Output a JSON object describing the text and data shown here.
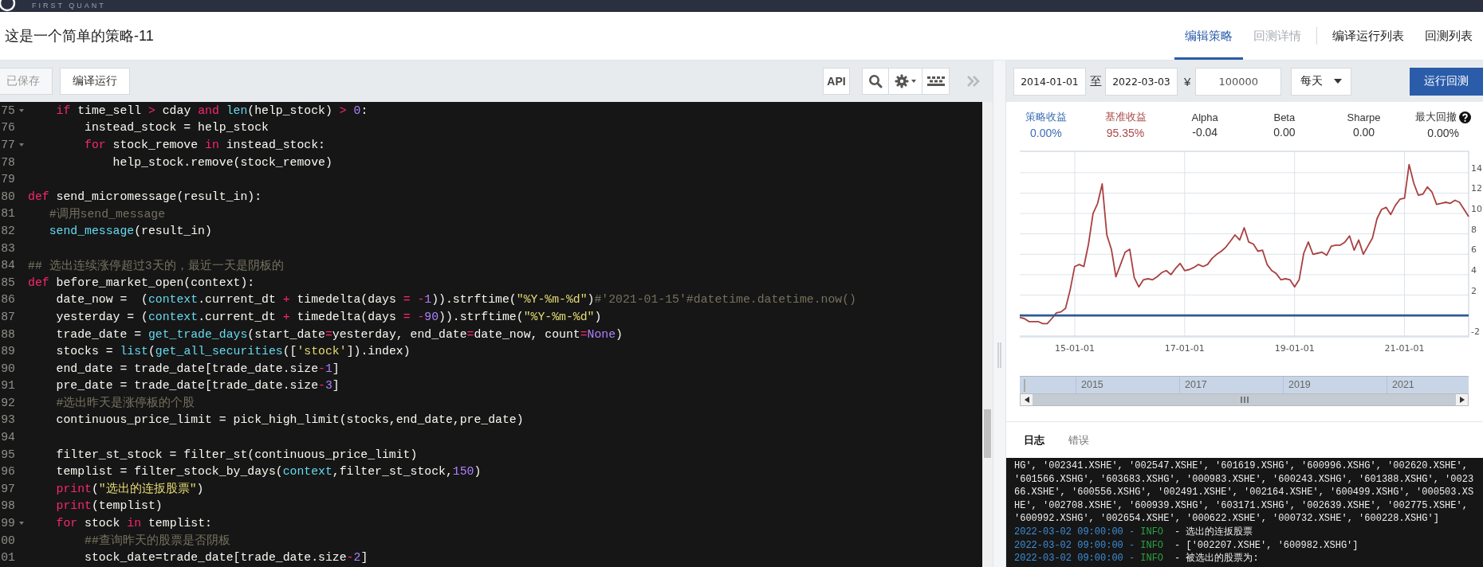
{
  "top_bar": {
    "brand": "FIRST QUANT"
  },
  "header": {
    "title": "这是一个简单的策略-11",
    "tabs": [
      {
        "label": "编辑策略",
        "selected": true,
        "disabled": false
      },
      {
        "label": "回测详情",
        "selected": false,
        "disabled": true
      },
      {
        "label": "编译运行列表",
        "selected": false,
        "disabled": false,
        "separator_before": true
      },
      {
        "label": "回测列表",
        "selected": false,
        "disabled": false
      }
    ]
  },
  "toolbar": {
    "buttons": [
      {
        "label": "已保存",
        "disabled": true
      },
      {
        "label": "编译运行",
        "disabled": false
      }
    ],
    "api_button": "API"
  },
  "editor": {
    "lines": [
      {
        "number": "75",
        "fold": true,
        "tokens": [
          {
            "kind": "kw",
            "text": "    if"
          },
          {
            "kind": "plain",
            "text": " time_sell "
          },
          {
            "kind": "op",
            "text": ">"
          },
          {
            "kind": "plain",
            "text": " cday "
          },
          {
            "kind": "kw",
            "text": "and "
          },
          {
            "kind": "builtin",
            "text": "len"
          },
          {
            "kind": "plain",
            "text": "(help_stock) "
          },
          {
            "kind": "op",
            "text": "> "
          },
          {
            "kind": "num",
            "text": "0"
          },
          {
            "kind": "plain",
            "text": ":"
          }
        ]
      },
      {
        "number": "76",
        "fold": false,
        "tokens": [
          {
            "kind": "plain",
            "text": "        instead_stock = help_stock"
          }
        ]
      },
      {
        "number": "77",
        "fold": true,
        "tokens": [
          {
            "kind": "kw",
            "text": "        for"
          },
          {
            "kind": "plain",
            "text": " stock_remove "
          },
          {
            "kind": "kw",
            "text": "in"
          },
          {
            "kind": "plain",
            "text": " instead_stock:"
          }
        ]
      },
      {
        "number": "78",
        "fold": false,
        "tokens": [
          {
            "kind": "plain",
            "text": "            help_stock.remove(stock_remove)"
          }
        ]
      },
      {
        "number": "79",
        "fold": false
      },
      {
        "number": "80",
        "fold": false,
        "tokens": [
          {
            "kind": "kw",
            "text": "def"
          },
          {
            "kind": "plain",
            "text": " send_micromessage(result_in):"
          }
        ]
      },
      {
        "number": "81",
        "fold": false,
        "tokens": [
          {
            "kind": "comment",
            "text": "   #调用send_message"
          }
        ]
      },
      {
        "number": "82",
        "fold": false,
        "tokens": [
          {
            "kind": "builtin",
            "text": "   send_message"
          },
          {
            "kind": "plain",
            "text": "(result_in)"
          }
        ]
      },
      {
        "number": "83",
        "fold": false
      },
      {
        "number": "84",
        "fold": false,
        "tokens": [
          {
            "kind": "comment",
            "text": "## 选出连续涨停超过3天的，最近一天是阴板的"
          }
        ]
      },
      {
        "number": "85",
        "fold": false,
        "tokens": [
          {
            "kind": "kw",
            "text": "def"
          },
          {
            "kind": "plain",
            "text": " before_market_open(context):"
          }
        ]
      },
      {
        "number": "86",
        "fold": false,
        "tokens": [
          {
            "kind": "plain",
            "text": "    date_now =  ("
          },
          {
            "kind": "param",
            "text": "context"
          },
          {
            "kind": "plain",
            "text": ".current_dt "
          },
          {
            "kind": "op",
            "text": "+"
          },
          {
            "kind": "plain",
            "text": " timedelta(days "
          },
          {
            "kind": "op",
            "text": "= -"
          },
          {
            "kind": "num",
            "text": "1"
          },
          {
            "kind": "plain",
            "text": ")).strftime("
          },
          {
            "kind": "str",
            "text": "\"%Y-%m-%d\""
          },
          {
            "kind": "plain",
            "text": ")"
          },
          {
            "kind": "comment",
            "text": "#'2021-01-15'#datetime.datetime.now()"
          }
        ]
      },
      {
        "number": "87",
        "fold": false,
        "tokens": [
          {
            "kind": "plain",
            "text": "    yesterday = ("
          },
          {
            "kind": "param",
            "text": "context"
          },
          {
            "kind": "plain",
            "text": ".current_dt "
          },
          {
            "kind": "op",
            "text": "+"
          },
          {
            "kind": "plain",
            "text": " timedelta(days "
          },
          {
            "kind": "op",
            "text": "= -"
          },
          {
            "kind": "num",
            "text": "90"
          },
          {
            "kind": "plain",
            "text": ")).strftime("
          },
          {
            "kind": "str",
            "text": "\"%Y-%m-%d\""
          },
          {
            "kind": "plain",
            "text": ")"
          }
        ]
      },
      {
        "number": "88",
        "fold": false,
        "tokens": [
          {
            "kind": "plain",
            "text": "    trade_date = "
          },
          {
            "kind": "builtin",
            "text": "get_trade_days"
          },
          {
            "kind": "plain",
            "text": "(start_date"
          },
          {
            "kind": "op",
            "text": "="
          },
          {
            "kind": "plain",
            "text": "yesterday, end_date"
          },
          {
            "kind": "op",
            "text": "="
          },
          {
            "kind": "plain",
            "text": "date_now, count"
          },
          {
            "kind": "op",
            "text": "="
          },
          {
            "kind": "num",
            "text": "None"
          },
          {
            "kind": "plain",
            "text": ")"
          }
        ]
      },
      {
        "number": "89",
        "fold": false,
        "tokens": [
          {
            "kind": "plain",
            "text": "    stocks = "
          },
          {
            "kind": "builtin",
            "text": "list"
          },
          {
            "kind": "plain",
            "text": "("
          },
          {
            "kind": "builtin",
            "text": "get_all_securities"
          },
          {
            "kind": "plain",
            "text": "(["
          },
          {
            "kind": "str",
            "text": "'stock'"
          },
          {
            "kind": "plain",
            "text": "]).index)"
          }
        ]
      },
      {
        "number": "90",
        "fold": false,
        "tokens": [
          {
            "kind": "plain",
            "text": "    end_date = trade_date[trade_date.size"
          },
          {
            "kind": "op",
            "text": "-"
          },
          {
            "kind": "num",
            "text": "1"
          },
          {
            "kind": "plain",
            "text": "]"
          }
        ]
      },
      {
        "number": "91",
        "fold": false,
        "tokens": [
          {
            "kind": "plain",
            "text": "    pre_date = trade_date[trade_date.size"
          },
          {
            "kind": "op",
            "text": "-"
          },
          {
            "kind": "num",
            "text": "3"
          },
          {
            "kind": "plain",
            "text": "]"
          }
        ]
      },
      {
        "number": "92",
        "fold": false,
        "tokens": [
          {
            "kind": "comment",
            "text": "    #选出昨天是涨停板的个股"
          }
        ]
      },
      {
        "number": "93",
        "fold": false,
        "tokens": [
          {
            "kind": "plain",
            "text": "    continuous_price_limit = pick_high_limit(stocks,end_date,pre_date)"
          }
        ]
      },
      {
        "number": "94",
        "fold": false
      },
      {
        "number": "95",
        "fold": false,
        "tokens": [
          {
            "kind": "plain",
            "text": "    filter_st_stock = filter_st(continuous_price_limit)"
          }
        ]
      },
      {
        "number": "96",
        "fold": false,
        "tokens": [
          {
            "kind": "plain",
            "text": "    templist = filter_stock_by_days("
          },
          {
            "kind": "param",
            "text": "context"
          },
          {
            "kind": "plain",
            "text": ",filter_st_stock,"
          },
          {
            "kind": "num",
            "text": "150"
          },
          {
            "kind": "plain",
            "text": ")"
          }
        ]
      },
      {
        "number": "97",
        "fold": false,
        "tokens": [
          {
            "kind": "kw",
            "text": "    print"
          },
          {
            "kind": "plain",
            "text": "("
          },
          {
            "kind": "str",
            "text": "\"选出的连扳股票\""
          },
          {
            "kind": "plain",
            "text": ")"
          }
        ]
      },
      {
        "number": "98",
        "fold": false,
        "tokens": [
          {
            "kind": "kw",
            "text": "    print"
          },
          {
            "kind": "plain",
            "text": "(templist)"
          }
        ]
      },
      {
        "number": "99",
        "fold": true,
        "tokens": [
          {
            "kind": "kw",
            "text": "    for"
          },
          {
            "kind": "plain",
            "text": " stock "
          },
          {
            "kind": "kw",
            "text": "in"
          },
          {
            "kind": "plain",
            "text": " templist:"
          }
        ]
      },
      {
        "number": "00",
        "fold": false,
        "tokens": [
          {
            "kind": "comment",
            "text": "        ##查询昨天的股票是否阴板"
          }
        ]
      },
      {
        "number": "01",
        "fold": false,
        "tokens": [
          {
            "kind": "plain",
            "text": "        stock_date=trade_date[trade_date.size"
          },
          {
            "kind": "op",
            "text": "-"
          },
          {
            "kind": "num",
            "text": "2"
          },
          {
            "kind": "plain",
            "text": "]"
          }
        ]
      }
    ]
  },
  "backtest": {
    "start_date": "2014-01-01",
    "to_label": "至",
    "end_date": "2022-03-03",
    "currency": "¥",
    "capital": "100000",
    "frequency": "每天",
    "run_button": "运行回测"
  },
  "stats": [
    {
      "label": "策略收益",
      "value": "0.00%",
      "color": "#3b6db3"
    },
    {
      "label": "基准收益",
      "value": "95.35%",
      "color": "#a94a4a"
    },
    {
      "label": "Alpha",
      "value": "-0.04",
      "color": "#333333"
    },
    {
      "label": "Beta",
      "value": "0.00",
      "color": "#333333"
    },
    {
      "label": "Sharpe",
      "value": "0.00",
      "color": "#333333"
    },
    {
      "label": "最大回撤",
      "value": "0.00%",
      "color": "#333333",
      "has_help": true
    }
  ],
  "chart": {
    "chart_data": {
      "type": "line",
      "grid": true,
      "ylim": [
        -2.1,
        16.1
      ],
      "categories": [
        null,
        null,
        null,
        null,
        null,
        null,
        null,
        null,
        null,
        null,
        null,
        null,
        "15-01-01",
        null,
        null,
        null,
        null,
        null,
        null,
        null,
        null,
        null,
        null,
        null,
        null,
        null,
        null,
        null,
        null,
        null,
        null,
        null,
        null,
        null,
        null,
        null,
        "17-01-01",
        null,
        null,
        null,
        null,
        null,
        null,
        null,
        null,
        null,
        null,
        null,
        null,
        null,
        null,
        null,
        null,
        null,
        null,
        null,
        null,
        null,
        null,
        null,
        "19-01-01",
        null,
        null,
        null,
        null,
        null,
        null,
        null,
        null,
        null,
        null,
        null,
        null,
        null,
        null,
        null,
        null,
        null,
        null,
        null,
        null,
        null,
        null,
        null,
        "21-01-01",
        null,
        null,
        null,
        null,
        null,
        null,
        null,
        null,
        null,
        null,
        null,
        null,
        null,
        null
      ],
      "yticks": [
        14,
        12,
        10,
        8,
        6,
        4,
        2,
        -2
      ],
      "series": [
        {
          "color": "#a94040",
          "values": [
            -0.2,
            -0.3,
            -0.6,
            -0.6,
            -0.6,
            -0.8,
            -0.8,
            -0.3,
            0.25,
            0.35,
            0.7,
            2.5,
            4.8,
            5.0,
            4.8,
            7.0,
            10.0,
            11.0,
            12.9,
            7.9,
            6.5,
            3.8,
            5.0,
            6.2,
            6.5,
            3.7,
            2.8,
            3.5,
            3.6,
            3.5,
            3.8,
            4.2,
            4.4,
            4.0,
            4.6,
            5.1,
            4.4,
            4.5,
            4.7,
            5.0,
            4.8,
            5.0,
            5.6,
            6.0,
            6.3,
            6.7,
            7.3,
            7.9,
            7.4,
            8.6,
            7.2,
            7.0,
            6.3,
            6.4,
            5.0,
            4.4,
            4.1,
            3.5,
            3.6,
            3.5,
            2.8,
            3.5,
            6.1,
            7.2,
            6.0,
            6.1,
            6.2,
            5.9,
            6.8,
            6.9,
            6.9,
            7.2,
            7.8,
            6.4,
            7.4,
            6.0,
            6.8,
            7.6,
            9.5,
            10.4,
            10.6,
            9.9,
            10.8,
            11.4,
            11.5,
            14.8,
            13.0,
            11.8,
            11.9,
            12.6,
            12.1,
            10.9,
            11.0,
            11.1,
            11.0,
            11.3,
            11.1,
            10.4,
            9.7
          ]
        },
        {
          "color": "#2f5a94",
          "values": [
            0,
            0,
            0,
            0,
            0,
            0,
            0,
            0,
            0,
            0,
            0,
            0,
            0,
            0,
            0,
            0,
            0,
            0,
            0,
            0,
            0,
            0,
            0,
            0,
            0,
            0,
            0,
            0,
            0,
            0,
            0,
            0,
            0,
            0,
            0,
            0,
            0,
            0,
            0,
            0,
            0,
            0,
            0,
            0,
            0,
            0,
            0,
            0,
            0,
            0,
            0,
            0,
            0,
            0,
            0,
            0,
            0,
            0,
            0,
            0,
            0,
            0,
            0,
            0,
            0,
            0,
            0,
            0,
            0,
            0,
            0,
            0,
            0,
            0,
            0,
            0,
            0,
            0,
            0,
            0,
            0,
            0,
            0,
            0,
            0,
            0,
            0,
            0,
            0,
            0,
            0,
            0,
            0,
            0,
            0,
            0,
            0,
            0,
            0
          ]
        }
      ]
    },
    "navigator": {
      "labels": [
        "2015",
        "2017",
        "2019",
        "2021"
      ]
    }
  },
  "log": {
    "tabs": [
      {
        "label": "日志",
        "selected": true
      },
      {
        "label": "错误",
        "selected": false
      }
    ],
    "wrapped_lines": [
      "HG', '002341.XSHE', '002547.XSHE', '601619.XSHG', '600996.XSHG', '002620.XSHE',",
      "'601566.XSHG', '603683.XSHG', '000983.XSHE', '600243.XSHG', '601388.XSHG', '0023",
      "66.XSHE', '600556.XSHG', '002491.XSHE', '002164.XSHE', '600499.XSHG', '000503.XS",
      "HE', '002708.XSHE', '600939.XSHG', '603171.XSHG', '002639.XSHE', '002775.XSHE',",
      "'600992.XSHG', '002654.XSHE', '000622.XSHE', '000732.XSHE', '600228.XSHG']"
    ],
    "entries": [
      {
        "time": "2022-03-02 09:00:00 -",
        "level": "INFO",
        "message": "- 选出的连扳股票"
      },
      {
        "time": "2022-03-02 09:00:00 -",
        "level": "INFO",
        "message": "- ['002207.XSHE', '600982.XSHG']"
      },
      {
        "time": "2022-03-02 09:00:00 -",
        "level": "INFO",
        "message": "- 被选出的股票为:"
      }
    ]
  }
}
